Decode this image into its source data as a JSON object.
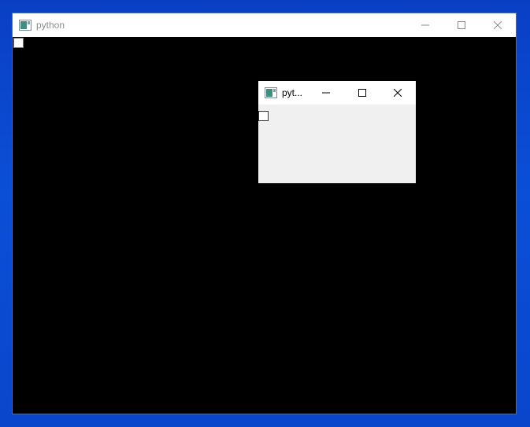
{
  "main_window": {
    "title": "python"
  },
  "child_window": {
    "title": "pyt..."
  },
  "colors": {
    "desktop": "#0b4fd6",
    "main_client": "#000000",
    "child_client": "#f0f0f0",
    "main_title_text": "#8c8c8c"
  }
}
